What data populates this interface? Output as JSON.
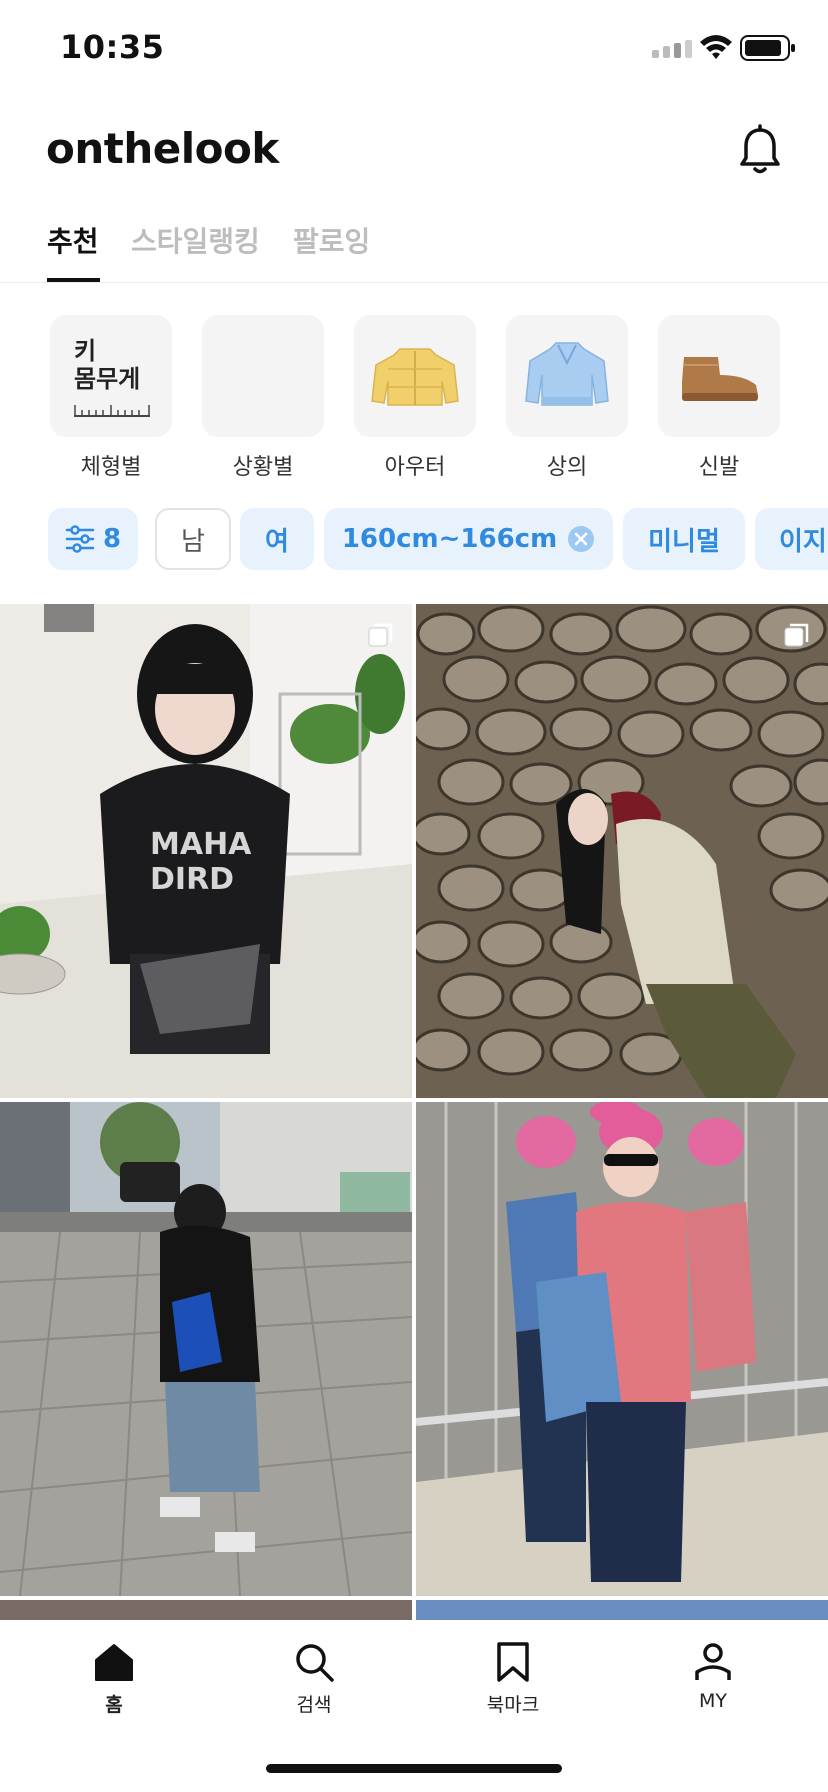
{
  "status_bar": {
    "time": "10:35"
  },
  "header": {
    "brand": "onthelook"
  },
  "tabs": [
    {
      "label": "추천",
      "active": true
    },
    {
      "label": "스타일랭킹",
      "active": false
    },
    {
      "label": "팔로잉",
      "active": false
    }
  ],
  "categories": [
    {
      "label": "체형별",
      "tile_text": "키\n몸무게"
    },
    {
      "label": "상황별"
    },
    {
      "label": "아우터",
      "icon": "puffer-jacket-icon"
    },
    {
      "label": "상의",
      "icon": "sweatshirt-icon"
    },
    {
      "label": "신발",
      "icon": "boot-icon"
    }
  ],
  "filters": {
    "count": "8",
    "chips": [
      "남",
      "여",
      "160cm~166cm",
      "미니멀",
      "이지"
    ]
  },
  "feed": {
    "posts": [
      {
        "name": "post-black-hoodie"
      },
      {
        "name": "post-stone-wall"
      },
      {
        "name": "post-street-plaza"
      },
      {
        "name": "post-elevator-mirror"
      }
    ]
  },
  "bottom_nav": [
    {
      "label": "홈",
      "icon": "home-icon",
      "active": true
    },
    {
      "label": "검색",
      "icon": "search-icon",
      "active": false
    },
    {
      "label": "북마크",
      "icon": "bookmark-icon",
      "active": false
    },
    {
      "label": "MY",
      "icon": "profile-icon",
      "active": false
    }
  ],
  "colors": {
    "accent": "#2f8ae0",
    "chip_bg": "#e8f2fd",
    "inactive_tab": "#bdbdbd"
  }
}
